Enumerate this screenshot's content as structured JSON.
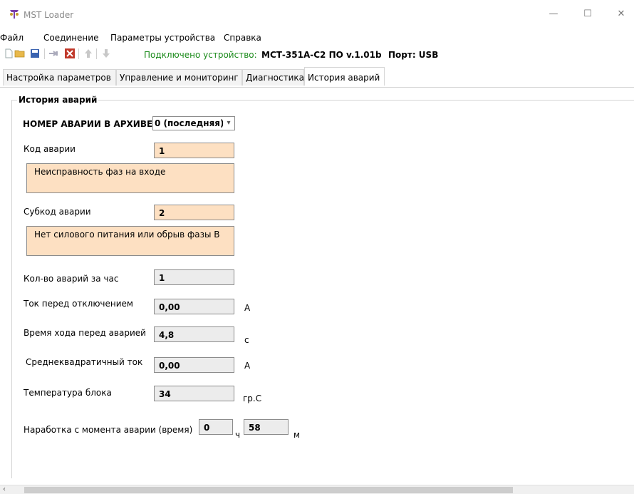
{
  "window": {
    "title": "MST Loader",
    "controls": {
      "minimize": "—",
      "maximize": "☐",
      "close": "✕"
    }
  },
  "menu": [
    "Файл",
    "Соединение",
    "Параметры устройства",
    "Справка"
  ],
  "toolbar": {
    "status": "Подключено устройство:",
    "device": "МСТ-351А-С2 ПО v.1.01b",
    "port": "Порт: USB",
    "icons": [
      "new-file-icon",
      "open-folder-icon",
      "save-icon",
      "connect-icon",
      "disconnect-icon",
      "upload-icon",
      "download-icon"
    ]
  },
  "tabs": [
    "Настройка параметров",
    "Управление и мониторинг",
    "Диагностика",
    "История аварий"
  ],
  "active_tab": 3,
  "group": {
    "title": "История аварий",
    "archive_label": "НОМЕР АВАРИИ В АРХИВЕ",
    "archive_value": "0 (последняя)",
    "fault_code_label": "Код аварии",
    "fault_code": "1",
    "fault_description": "Неисправность фаз на входе",
    "subcode_label": "Субкод аварии",
    "subcode": "2",
    "subcode_description": "Нет силового питания или обрыв фазы В",
    "count_label": "Кол-во аварий за час",
    "count": "1",
    "current_label": "Ток перед отключением",
    "current": "0,00",
    "current_unit": "А",
    "runtime_label": "Время хода перед аварией",
    "runtime": "4,8",
    "runtime_unit": "с",
    "rms_label": "Среднеквадратичный ток",
    "rms": "0,00",
    "rms_unit": "А",
    "temp_label": "Температура блока",
    "temp": "34",
    "temp_unit": "гр.С",
    "since_label": "Наработка с момента аварии (время)",
    "since_hours": "0",
    "hours_unit": "ч",
    "since_minutes": "58",
    "minutes_unit": "м"
  },
  "colors": {
    "field_orange": "#fde0c2",
    "field_grey": "#ececec",
    "status_green": "#1a8a1a"
  }
}
